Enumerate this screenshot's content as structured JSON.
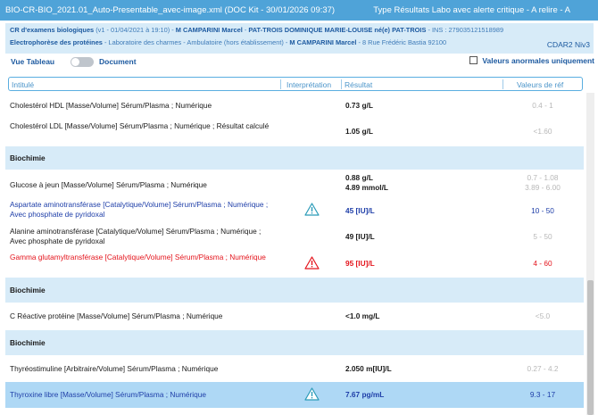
{
  "titlebar": {
    "document": "BIO-CR-BIO_2021.01_Auto-Presentable_avec-image.xml (DOC Kit - 30/01/2026 09:37)",
    "type": "Type Résultats Labo avec alerte critique -  A relire - A"
  },
  "info": {
    "doc_label": "CR d'examens biologiques",
    "doc_version": " (v1 - 01/04/2021 à 19:10) - ",
    "patient1": "M CAMPARINI Marcel",
    "sep1": " - ",
    "patient2": "PAT-TROIS DOMINIQUE MARIE-LOUISE né(e) PAT-TROIS",
    "ins": " - INS : 279035121518989",
    "exam_label": "Electrophorèse des protéines",
    "lab": " - Laboratoire des charmes - Ambulatoire (hors établissement) - ",
    "doctor": "M CAMPARINI Marcel",
    "address": " - 8 Rue Frédéric Bastia 92100",
    "cdar": "CDAR2 Niv3"
  },
  "view_toggle": {
    "left_label": "Vue Tableau",
    "right_label": "Document",
    "checked": false
  },
  "abnormal_only": {
    "label": "Valeurs anormales uniquement",
    "checked": false
  },
  "table": {
    "headers": {
      "intitule": "Intitulé",
      "interpretation": "Interprétation",
      "resultat": "Résultat",
      "ref": "Valeurs de réf"
    },
    "rows": [
      {
        "kind": "data",
        "label": "Cholestérol HDL [Masse/Volume] Sérum/Plasma ; Numérique",
        "result": "0.73 g/L",
        "ref": "0.4 - 1",
        "status": "normal"
      },
      {
        "kind": "data",
        "label": "Cholestérol LDL [Masse/Volume] Sérum/Plasma ; Numérique ; Résultat calculé",
        "result": "1.05 g/L",
        "ref": "<1.60",
        "status": "normal"
      },
      {
        "kind": "section",
        "label": "Biochimie"
      },
      {
        "kind": "data",
        "label": "Glucose à jeun [Masse/Volume] Sérum/Plasma ; Numérique",
        "result": "0.88 g/L",
        "result2": "4.89 mmol/L",
        "ref": "0.7 - 1.08",
        "ref2": "3.89 - 6.00",
        "status": "normal"
      },
      {
        "kind": "data",
        "label": "Aspartate aminotransférase [Catalytique/Volume] Sérum/Plasma ; Numérique ; Avec phosphate de pyridoxal",
        "result": "45 [IU]/L",
        "ref": "10 - 50",
        "status": "warning",
        "icon": "warning-triangle-icon"
      },
      {
        "kind": "data",
        "label": "Alanine aminotransférase [Catalytique/Volume] Sérum/Plasma ; Numérique ; Avec phosphate de pyridoxal",
        "result": "49 [IU]/L",
        "ref": "5 - 50",
        "status": "normal"
      },
      {
        "kind": "data",
        "label": "Gamma glutamyltransférase [Catalytique/Volume] Sérum/Plasma ; Numérique",
        "result": "95 [IU]/L",
        "ref": "4 - 60",
        "status": "critical",
        "icon": "alert-triangle-icon"
      },
      {
        "kind": "section",
        "label": "Biochimie"
      },
      {
        "kind": "data",
        "label": "C Réactive protéine [Masse/Volume] Sérum/Plasma ; Numérique",
        "result": "<1.0 mg/L",
        "ref": "<5.0",
        "status": "normal"
      },
      {
        "kind": "section",
        "label": "Biochimie"
      },
      {
        "kind": "data",
        "label": "Thyréostimuline [Arbitraire/Volume] Sérum/Plasma ; Numérique",
        "result": "2.050 m[IU]/L",
        "ref": "0.27 - 4.2",
        "status": "normal"
      },
      {
        "kind": "data",
        "label": "Thyroxine libre [Masse/Volume] Sérum/Plasma ; Numérique",
        "result": "7.67 pg/mL",
        "ref": "9.3 - 17",
        "status": "warning",
        "icon": "warning-triangle-icon",
        "selected": true
      }
    ]
  },
  "colors": {
    "titlebar": "#4fa3d8",
    "section_bg": "#d7ebf8",
    "selected_bg": "#aed8f5",
    "warning": "#1e3ea8",
    "critical": "#e4141c",
    "warning_icon": "#2a9bb8"
  }
}
